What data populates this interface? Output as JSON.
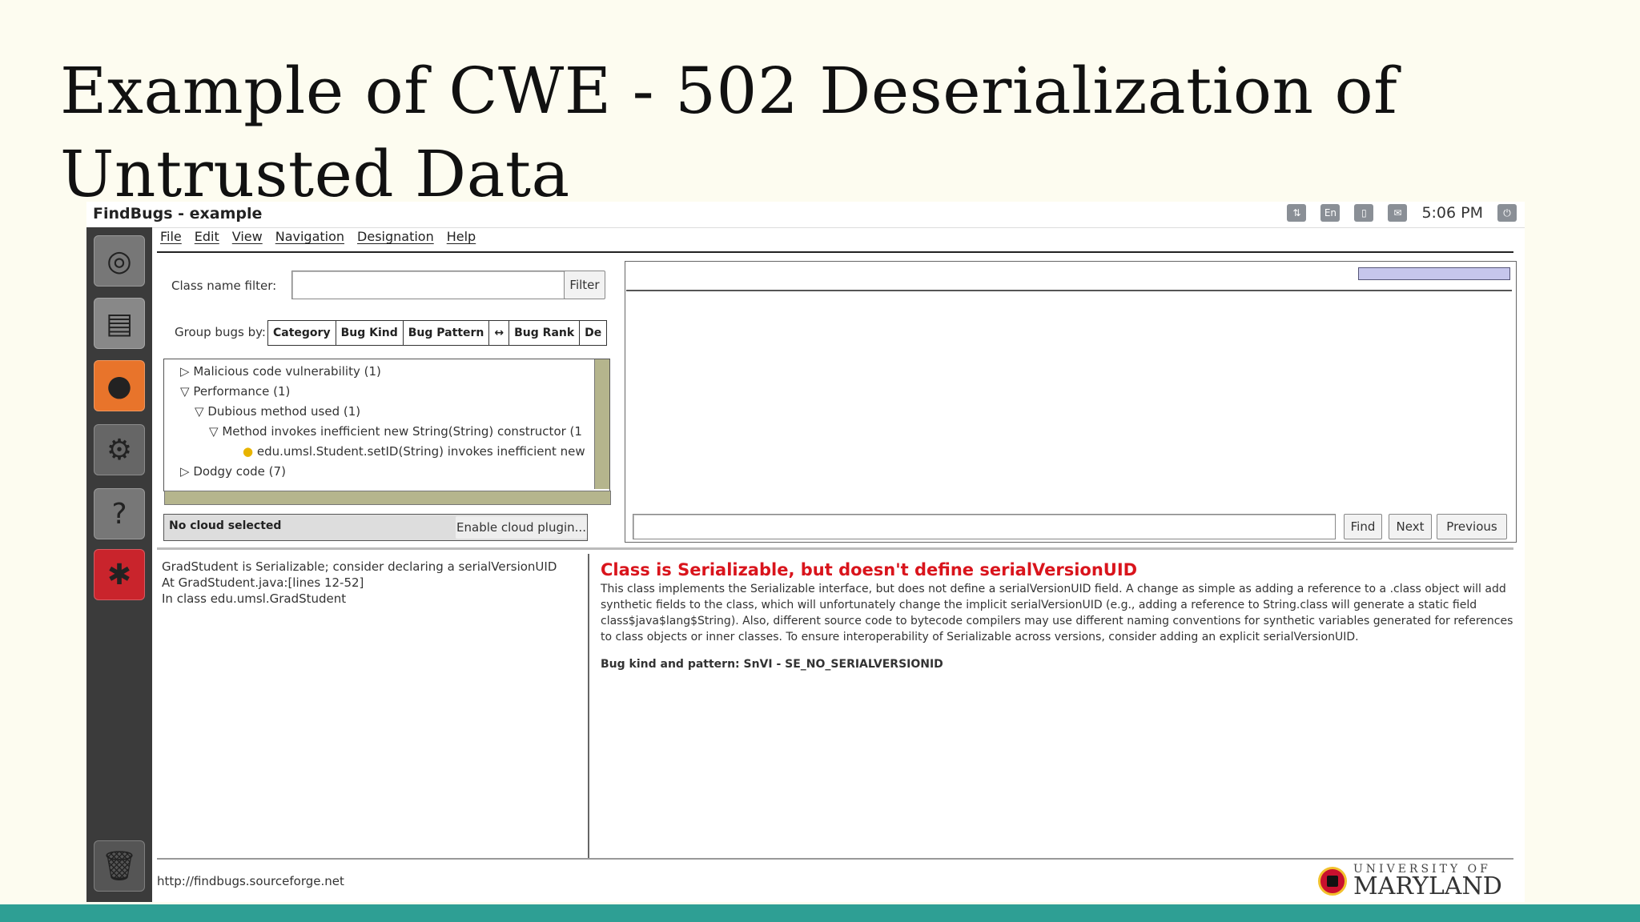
{
  "slide": {
    "title_line1": "Example of CWE - 502 Deserialization of",
    "title_line2": "Untrusted Data"
  },
  "window": {
    "title": "FindBugs - example",
    "clock": "5:06 PM",
    "tray_icon_text": "En"
  },
  "menu": [
    "File",
    "Edit",
    "View",
    "Navigation",
    "Designation",
    "Help"
  ],
  "filter": {
    "label": "Class name filter:",
    "value": "",
    "button": "Filter"
  },
  "group": {
    "label": "Group bugs by:",
    "tabs": [
      "Category",
      "Bug Kind",
      "Bug Pattern",
      "↔",
      "Bug Rank",
      "De"
    ]
  },
  "tree": {
    "items": [
      "Malicious code vulnerability (1)",
      "Performance (1)",
      "Dubious method used (1)",
      "Method invokes inefficient new String(String) constructor (1",
      "edu.umsl.Student.setID(String) invokes inefficient new",
      "Dodgy code (7)"
    ]
  },
  "cloud": {
    "status": "No cloud selected",
    "button": "Enable cloud plugin..."
  },
  "search": {
    "value": "",
    "find": "Find",
    "next": "Next",
    "previous": "Previous"
  },
  "details_left": {
    "line1": "GradStudent is Serializable; consider declaring a serialVersionUID",
    "line2": "At GradStudent.java:[lines 12-52]",
    "line3": "In class edu.umsl.GradStudent"
  },
  "details_right": {
    "title": "Class is Serializable, but doesn't define serialVersionUID",
    "body": "This class implements the Serializable interface, but does not define a serialVersionUID field.  A change as simple as adding a reference to a .class object will add synthetic fields to the class, which will unfortunately change the implicit serialVersionUID (e.g., adding a reference to String.class will generate a static field class$java$lang$String). Also, different source code to bytecode compilers may use different naming conventions for synthetic variables generated for references to class objects or inner classes. To ensure interoperability of Serializable across versions, consider adding an explicit serialVersionUID.",
    "pattern": "Bug kind and pattern: SnVI - SE_NO_SERIALVERSIONID"
  },
  "status": {
    "url": "http://findbugs.sourceforge.net"
  },
  "logo": {
    "small": "UNIVERSITY OF",
    "big": "MARYLAND"
  },
  "colors": {
    "accent_footer": "#2e9f94",
    "bug_title": "#d9141c"
  }
}
